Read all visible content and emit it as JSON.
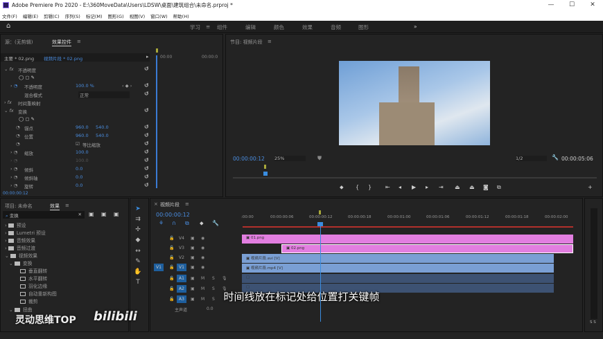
{
  "window": {
    "title": "Adobe Premiere Pro 2020 - E:\\360MoveData\\Users\\LDSW\\桌面\\建筑组合\\未命名.prproj *",
    "controls": [
      "—",
      "☐",
      "✕"
    ]
  },
  "menu": [
    "文件(F)",
    "编辑(E)",
    "剪辑(C)",
    "序列(S)",
    "标记(M)",
    "图形(G)",
    "视图(V)",
    "窗口(W)",
    "帮助(H)"
  ],
  "workspaces": {
    "active": "学习",
    "items": [
      "学习",
      "组件",
      "编辑",
      "颜色",
      "效果",
      "音频",
      "图形"
    ],
    "more": "»"
  },
  "effect_controls": {
    "tabs": [
      "源：(无剪辑)",
      "效果控件"
    ],
    "master": "主要 * 02.png",
    "clip": "视频片段 * 02.png",
    "time_start": "00:00",
    "time_end": "00:00:0",
    "opacity_header": "不透明度",
    "opacity_label": "不透明度",
    "opacity_value": "100.0 %",
    "blend_label": "混合模式",
    "blend_value": "正常",
    "time_remap": "时间重映射",
    "transform": "变换",
    "anchor_label": "锚点",
    "anchor_x": "960.0",
    "anchor_y": "540.0",
    "position_label": "位置",
    "position_x": "960.0",
    "position_y": "540.0",
    "uniform_scale": "等比缩放",
    "scale_label": "缩放",
    "scale_value": "100.0",
    "scale_width_value": "100.0",
    "skew_label": "倾斜",
    "skew_value": "0.0",
    "skew_axis_label": "倾斜轴",
    "skew_axis_value": "0.0",
    "rotation_label": "旋转",
    "rotation_value": "0.0",
    "current_time": "00:00:00:12"
  },
  "program": {
    "title": "节目: 视频片段",
    "timecode": "00:00:00:12",
    "zoom": "25%",
    "resolution": "1/2",
    "duration": "00:00:05:06"
  },
  "project": {
    "tabs": [
      "项目: 未命名",
      "效果"
    ],
    "search": "变换",
    "tree": [
      "预设",
      "Lumetri 预设",
      "音频效果",
      "音频过渡",
      "视频效果",
      "变换",
      "垂直翻转",
      "水平翻转",
      "羽化边缘",
      "自动重新构图",
      "裁剪",
      "扭曲"
    ]
  },
  "timeline": {
    "title": "视频片段",
    "timecode": "00:00:00:12",
    "ticks": [
      ":00:00",
      "00:00:00:06",
      "00:00:00:12",
      "00:00:00:18",
      "00:00:01:00",
      "00:00:01:06",
      "00:00:01:12",
      "00:00:01:18",
      "00:00:02:00"
    ],
    "tracks": [
      "V4",
      "V3",
      "V2",
      "V1",
      "A1",
      "A2",
      "A3"
    ],
    "source_patch": "V1",
    "master": "主声道",
    "master_value": "0.0",
    "clips": [
      {
        "name": "01.png",
        "color": "#e27ee0"
      },
      {
        "name": "02.png",
        "color": "#e27ee0"
      },
      {
        "name": "视频片段.avi [V]",
        "color": "#7a9fd4"
      },
      {
        "name": "视频片段.mp4 [V]",
        "color": "#7a9fd4"
      }
    ]
  },
  "subtitle": "时间线放在标记处给位置打关键帧",
  "watermark": {
    "text": "灵动思维TOP",
    "logo": "bilibili"
  },
  "meter": {
    "label": "S S"
  }
}
